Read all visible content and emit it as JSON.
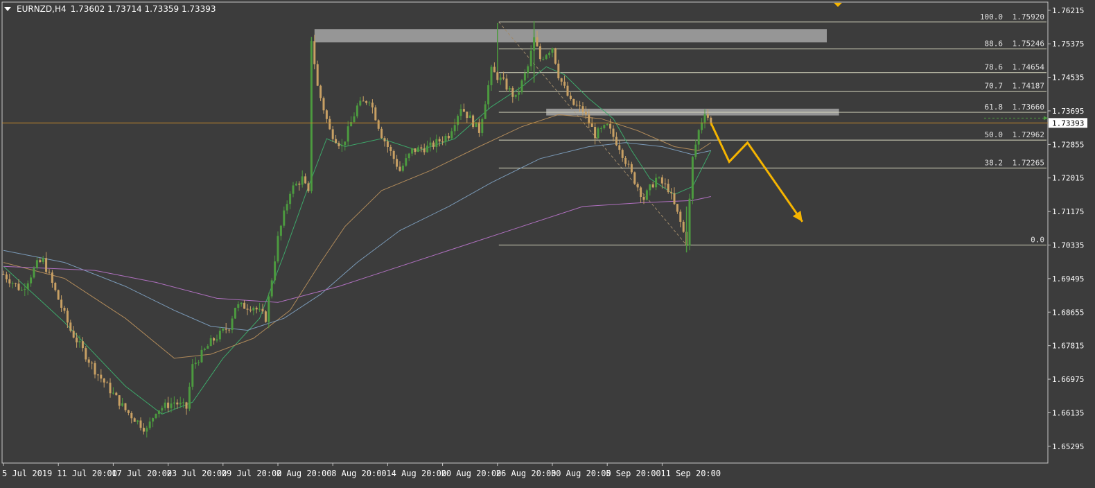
{
  "header": {
    "symbol": "EURNZD,H4",
    "ohlc": "1.73602 1.73714 1.73359 1.73393"
  },
  "colors": {
    "background": "#3c3c3c",
    "frame": "#c8c8c8",
    "bull": "#4c9a3f",
    "bear": "#c8a064",
    "current_price_line": "#c88a2a",
    "fib": "#d8d8c0",
    "zone": "#a0a0a0",
    "arrow": "#f5b400",
    "ma_fast": "#3da86a",
    "ma_mid": "#b08a5a",
    "ma_slow": "#7a9ab8",
    "ma_long": "#b070c0"
  },
  "chart_data": {
    "type": "candlestick",
    "title": "",
    "ylim": [
      1.64875,
      1.7642
    ],
    "y_ticks": [
      "1.76215",
      "1.75375",
      "1.74535",
      "1.73695",
      "1.72855",
      "1.72015",
      "1.71175",
      "1.70335",
      "1.69495",
      "1.68655",
      "1.67815",
      "1.66975",
      "1.66135",
      "1.65295"
    ],
    "x_ticks": [
      "5 Jul 2019",
      "11 Jul 20:00",
      "17 Jul 20:00",
      "23 Jul 20:00",
      "29 Jul 20:00",
      "2 Aug 20:00",
      "8 Aug 20:00",
      "14 Aug 20:00",
      "20 Aug 20:00",
      "26 Aug 20:00",
      "30 Aug 20:00",
      "5 Sep 20:00",
      "11 Sep 20:00"
    ],
    "x_tick_bar_index": [
      0,
      18,
      36,
      54,
      72,
      90,
      108,
      126,
      144,
      162,
      180,
      198,
      216
    ],
    "current_price": "1.73393",
    "candles_total": 230,
    "price_path_keypoints": [
      [
        0,
        1.696
      ],
      [
        6,
        1.692
      ],
      [
        11,
        1.6985
      ],
      [
        13,
        1.6995
      ],
      [
        22,
        1.682
      ],
      [
        30,
        1.672
      ],
      [
        40,
        1.662
      ],
      [
        47,
        1.657
      ],
      [
        50,
        1.662
      ],
      [
        56,
        1.664
      ],
      [
        60,
        1.6625
      ],
      [
        62,
        1.673
      ],
      [
        68,
        1.679
      ],
      [
        74,
        1.683
      ],
      [
        76,
        1.688
      ],
      [
        82,
        1.688
      ],
      [
        86,
        1.685
      ],
      [
        90,
        1.705
      ],
      [
        94,
        1.717
      ],
      [
        98,
        1.72
      ],
      [
        100,
        1.716
      ],
      [
        101,
        1.755
      ],
      [
        103,
        1.743
      ],
      [
        107,
        1.732
      ],
      [
        111,
        1.728
      ],
      [
        116,
        1.738
      ],
      [
        120,
        1.74
      ],
      [
        124,
        1.731
      ],
      [
        130,
        1.722
      ],
      [
        134,
        1.727
      ],
      [
        140,
        1.728
      ],
      [
        146,
        1.731
      ],
      [
        150,
        1.738
      ],
      [
        156,
        1.732
      ],
      [
        160,
        1.747
      ],
      [
        164,
        1.744
      ],
      [
        168,
        1.74
      ],
      [
        172,
        1.748
      ],
      [
        174,
        1.755
      ],
      [
        176,
        1.75
      ],
      [
        180,
        1.753
      ],
      [
        182,
        1.746
      ],
      [
        186,
        1.739
      ],
      [
        190,
        1.737
      ],
      [
        194,
        1.731
      ],
      [
        198,
        1.733
      ],
      [
        202,
        1.728
      ],
      [
        206,
        1.721
      ],
      [
        210,
        1.715
      ],
      [
        214,
        1.72
      ],
      [
        218,
        1.7175
      ],
      [
        222,
        1.709
      ],
      [
        224,
        1.704
      ],
      [
        226,
        1.725
      ],
      [
        228,
        1.732
      ],
      [
        230,
        1.737
      ],
      [
        232,
        1.7339
      ]
    ],
    "moving_averages": [
      {
        "key": "ma_fast",
        "points": [
          [
            0,
            1.698
          ],
          [
            20,
            1.684
          ],
          [
            40,
            1.668
          ],
          [
            52,
            1.661
          ],
          [
            62,
            1.664
          ],
          [
            72,
            1.675
          ],
          [
            84,
            1.685
          ],
          [
            92,
            1.701
          ],
          [
            100,
            1.718
          ],
          [
            106,
            1.73
          ],
          [
            112,
            1.728
          ],
          [
            124,
            1.73
          ],
          [
            136,
            1.727
          ],
          [
            148,
            1.73
          ],
          [
            160,
            1.738
          ],
          [
            170,
            1.743
          ],
          [
            178,
            1.748
          ],
          [
            184,
            1.746
          ],
          [
            192,
            1.74
          ],
          [
            200,
            1.735
          ],
          [
            206,
            1.727
          ],
          [
            212,
            1.72
          ],
          [
            220,
            1.716
          ],
          [
            226,
            1.718
          ],
          [
            232,
            1.727
          ]
        ]
      },
      {
        "key": "ma_mid",
        "points": [
          [
            0,
            1.699
          ],
          [
            20,
            1.695
          ],
          [
            40,
            1.685
          ],
          [
            56,
            1.675
          ],
          [
            68,
            1.676
          ],
          [
            82,
            1.68
          ],
          [
            94,
            1.687
          ],
          [
            104,
            1.699
          ],
          [
            112,
            1.708
          ],
          [
            124,
            1.717
          ],
          [
            140,
            1.722
          ],
          [
            156,
            1.728
          ],
          [
            170,
            1.733
          ],
          [
            182,
            1.736
          ],
          [
            196,
            1.735
          ],
          [
            208,
            1.732
          ],
          [
            220,
            1.728
          ],
          [
            228,
            1.727
          ],
          [
            232,
            1.729
          ]
        ]
      },
      {
        "key": "ma_slow",
        "points": [
          [
            0,
            1.702
          ],
          [
            20,
            1.699
          ],
          [
            40,
            1.693
          ],
          [
            56,
            1.687
          ],
          [
            68,
            1.683
          ],
          [
            80,
            1.682
          ],
          [
            92,
            1.685
          ],
          [
            104,
            1.691
          ],
          [
            116,
            1.699
          ],
          [
            130,
            1.707
          ],
          [
            146,
            1.713
          ],
          [
            160,
            1.719
          ],
          [
            176,
            1.725
          ],
          [
            192,
            1.728
          ],
          [
            204,
            1.729
          ],
          [
            216,
            1.728
          ],
          [
            226,
            1.726
          ],
          [
            232,
            1.727
          ]
        ]
      },
      {
        "key": "ma_long",
        "points": [
          [
            0,
            1.698
          ],
          [
            30,
            1.697
          ],
          [
            50,
            1.694
          ],
          [
            70,
            1.69
          ],
          [
            90,
            1.689
          ],
          [
            110,
            1.693
          ],
          [
            130,
            1.698
          ],
          [
            150,
            1.703
          ],
          [
            170,
            1.708
          ],
          [
            190,
            1.713
          ],
          [
            210,
            1.714
          ],
          [
            226,
            1.7145
          ],
          [
            232,
            1.7155
          ]
        ]
      }
    ],
    "fibonacci": {
      "start_bar": 162,
      "end_bar": 224,
      "levels": [
        {
          "ratio": "100.0",
          "price": "1.75920"
        },
        {
          "ratio": "88.6",
          "price": "1.75246"
        },
        {
          "ratio": "78.6",
          "price": "1.74654"
        },
        {
          "ratio": "70.7",
          "price": "1.74187"
        },
        {
          "ratio": "61.8",
          "price": "1.73660"
        },
        {
          "ratio": "50.0",
          "price": "1.72962"
        },
        {
          "ratio": "38.2",
          "price": "1.72265"
        },
        {
          "ratio": "0.0",
          "price": "1.70335"
        }
      ]
    },
    "zones": [
      {
        "from_bar": 102,
        "to_bar": 270,
        "top": 1.7574,
        "bottom": 1.7541
      },
      {
        "from_bar": 178,
        "to_bar": 274,
        "top": 1.7375,
        "bottom": 1.7358
      }
    ],
    "projection_arrow": [
      [
        232,
        1.73393
      ],
      [
        238,
        1.7242
      ],
      [
        244,
        1.729
      ],
      [
        262,
        1.7092
      ]
    ]
  }
}
